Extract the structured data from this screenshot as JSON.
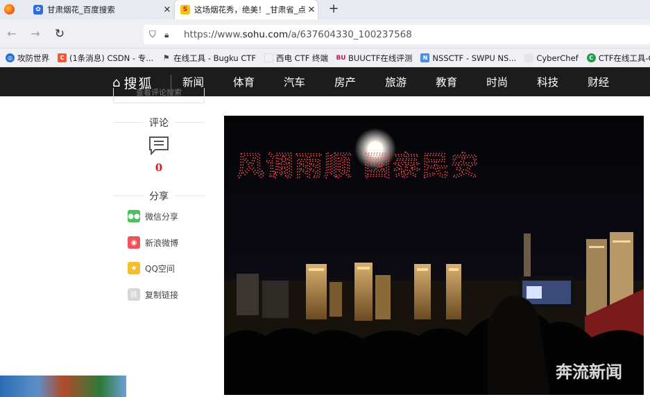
{
  "browser": {
    "tabs": [
      {
        "title": "甘肃烟花_百度搜索",
        "favicon": "baidu-paw-icon",
        "active": false
      },
      {
        "title": "这场烟花秀，绝美！_甘肃省_点",
        "favicon": "sohu-icon",
        "active": true
      }
    ],
    "url": {
      "prefix": "https://www.",
      "domain": "sohu.com",
      "path": "/a/637604330_100237568"
    },
    "bookmarks": [
      {
        "label": "攻防世界",
        "icon": "globe-icon",
        "color": "#2a6fd6"
      },
      {
        "label": "(1条消息) CSDN - 专...",
        "icon": "csdn-icon",
        "color": "#fc5531"
      },
      {
        "label": "在线工具 - Bugku CTF",
        "icon": "flag-icon",
        "color": "#444444"
      },
      {
        "label": "西电 CTF 终端",
        "icon": "page-icon",
        "color": "#cccccc"
      },
      {
        "label": "BUUCTF在线评测",
        "icon": "buu-icon",
        "color": "#c2185b"
      },
      {
        "label": "NSSCTF - SWPU NS...",
        "icon": "nss-icon",
        "color": "#4a8fe7"
      },
      {
        "label": "CyberChef",
        "icon": "chef-icon",
        "color": "#aaaaaa"
      },
      {
        "label": "CTF在线工具-CT",
        "icon": "ctf-tool-icon",
        "color": "#1e9e4a"
      }
    ]
  },
  "sohu": {
    "logo": "搜狐",
    "nav": [
      "新闻",
      "体育",
      "汽车",
      "房产",
      "旅游",
      "教育",
      "时尚",
      "科技",
      "财经"
    ],
    "partial_box_text": "查看评论搜索"
  },
  "sidebar": {
    "comment_label": "评论",
    "comment_count": "0",
    "share_label": "分享",
    "share_items": [
      {
        "label": "微信分享",
        "icon": "wechat-icon",
        "color": "#4cbf5e"
      },
      {
        "label": "新浪微博",
        "icon": "weibo-icon",
        "color": "#f0525a"
      },
      {
        "label": "QQ空间",
        "icon": "qzone-icon",
        "color": "#f6bd2c"
      },
      {
        "label": "复制链接",
        "icon": "link-icon",
        "color": "#d6d6d6"
      }
    ]
  },
  "photo": {
    "drone_text": "风调雨顺 国泰民安",
    "watermark": "奔流新闻"
  }
}
